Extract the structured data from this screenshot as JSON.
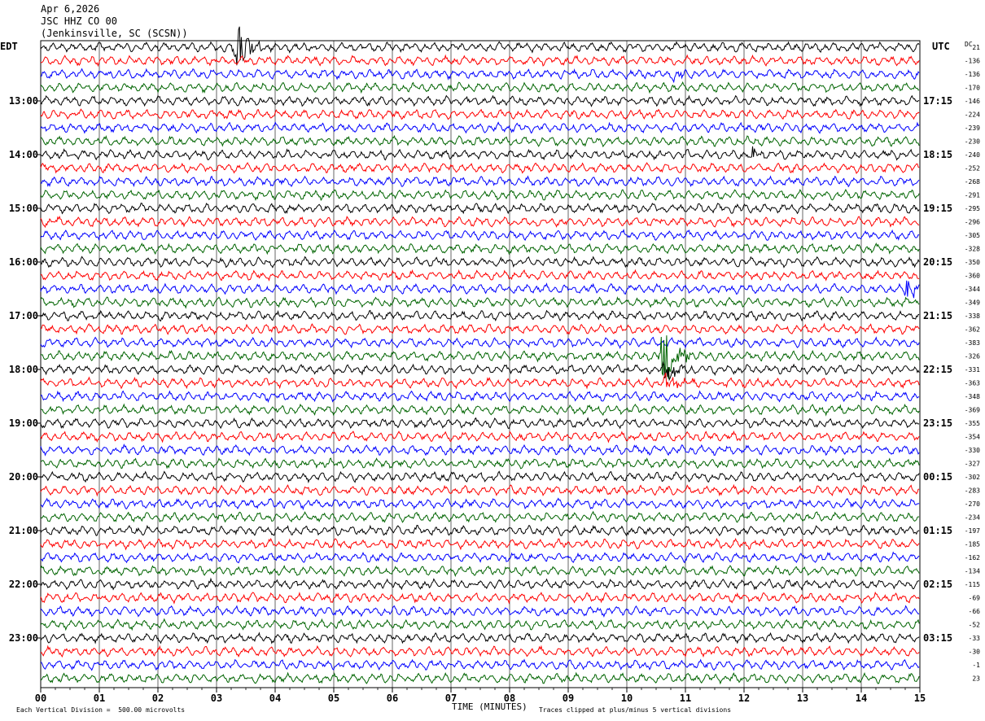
{
  "header": {
    "date": "Apr 6,2026",
    "station": "JSC HHZ CO 00",
    "location": "(Jenkinsville, SC (SCSN))"
  },
  "labels": {
    "left_tz": "EDT",
    "right_tz": "UTC",
    "dc": "DC",
    "xlabel": "TIME (MINUTES)",
    "scale_note": "Each Vertical Division =  500.00 microvolts",
    "clip_note": "Traces clipped at plus/minus 5 vertical divisions"
  },
  "colors": {
    "trace_cycle": [
      "#000000",
      "#ff0000",
      "#0000ff",
      "#006400"
    ],
    "grid": "#000000"
  },
  "chart_data": {
    "type": "line",
    "title": "JSC HHZ CO 00",
    "xlabel": "TIME (MINUTES)",
    "xlim": [
      0,
      15
    ],
    "x_ticks": [
      "00",
      "01",
      "02",
      "03",
      "04",
      "05",
      "06",
      "07",
      "08",
      "09",
      "10",
      "11",
      "12",
      "13",
      "14",
      "15"
    ],
    "rows": 48,
    "minutes_per_row": 15,
    "left_hour_labels": [
      "13:00",
      "14:00",
      "15:00",
      "16:00",
      "17:00",
      "18:00",
      "19:00",
      "20:00",
      "21:00",
      "22:00",
      "23:00"
    ],
    "right_hour_labels": [
      "17:15",
      "18:15",
      "19:15",
      "20:15",
      "21:15",
      "22:15",
      "23:15",
      "00:15",
      "01:15",
      "02:15",
      "03:15"
    ],
    "dc_offsets": [
      "21",
      "-136",
      "-136",
      "-170",
      "-146",
      "-224",
      "-239",
      "-230",
      "-240",
      "-252",
      "-268",
      "-291",
      "-295",
      "-296",
      "-305",
      "-328",
      "-350",
      "-360",
      "-344",
      "-349",
      "-338",
      "-362",
      "-383",
      "-326",
      "-331",
      "-363",
      "-348",
      "-369",
      "-355",
      "-354",
      "-330",
      "-327",
      "-302",
      "-283",
      "-270",
      "-234",
      "-197",
      "-185",
      "-162",
      "-134",
      "-115",
      "-69",
      "-66",
      "-52",
      "-33",
      "-30",
      "-1",
      "23"
    ],
    "events": [
      {
        "row": 0,
        "minute": 3.35,
        "amplitude": 4.0
      },
      {
        "row": 0,
        "minute": 3.3,
        "amplitude": 2.2
      },
      {
        "row": 8,
        "minute": 12.1,
        "amplitude": 1.2
      },
      {
        "row": 18,
        "minute": 14.75,
        "amplitude": 1.6
      },
      {
        "row": 23,
        "minute": 10.6,
        "amplitude": 6.0
      },
      {
        "row": 24,
        "minute": 10.65,
        "amplitude": 2.5
      },
      {
        "row": 25,
        "minute": 10.65,
        "amplitude": 1.5
      },
      {
        "row": 2,
        "minute": 10.8,
        "amplitude": 1.0
      }
    ]
  }
}
